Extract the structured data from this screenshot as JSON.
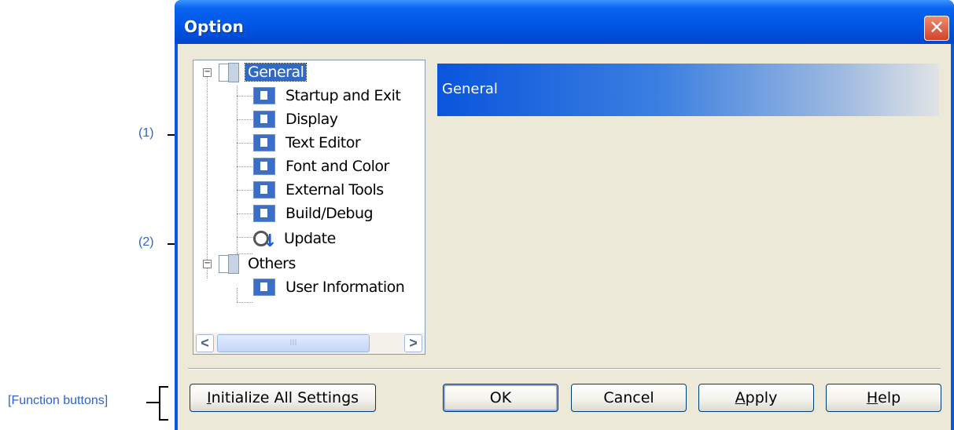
{
  "window": {
    "title": "Option"
  },
  "tree": {
    "items": [
      {
        "label": "General",
        "kind": "folder",
        "expanded": true,
        "selected": true
      },
      {
        "label": "Startup and Exit",
        "kind": "page"
      },
      {
        "label": "Display",
        "kind": "page"
      },
      {
        "label": "Text Editor",
        "kind": "page"
      },
      {
        "label": "Font and Color",
        "kind": "page"
      },
      {
        "label": "External Tools",
        "kind": "page"
      },
      {
        "label": "Build/Debug",
        "kind": "page"
      },
      {
        "label": "Update",
        "kind": "update"
      },
      {
        "label": "Others",
        "kind": "folder",
        "expanded": true
      },
      {
        "label": "User Information",
        "kind": "page"
      }
    ],
    "scroll_left": "<",
    "scroll_right": ">",
    "thumb_grip": "III"
  },
  "panel": {
    "header": "General"
  },
  "buttons": {
    "initialize": {
      "mnemonic": "I",
      "rest": "nitialize All Settings"
    },
    "ok": "OK",
    "cancel": "Cancel",
    "apply": {
      "mnemonic": "A",
      "rest": "pply"
    },
    "help": {
      "mnemonic": "H",
      "rest": "elp"
    }
  },
  "callouts": {
    "one": "(1)",
    "two": "(2)",
    "function_buttons": "[Function buttons]"
  },
  "colors": {
    "title_bar": "#0058e6",
    "selection": "#316ac5",
    "callout_text": "#2f63c8",
    "dialog_face": "#ece9d8"
  }
}
